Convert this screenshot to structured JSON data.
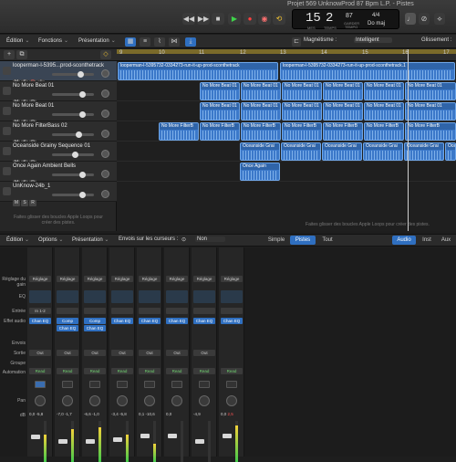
{
  "window": {
    "title": "Projet  569 UnknowProd 87 Bpm L.P. - Pistes"
  },
  "lcd": {
    "bar": "15",
    "beat": "2",
    "bar_label": "MES",
    "beat_label": "TEMPS",
    "tempo": "87",
    "tempo_label": "GARDER",
    "tempo_sub": "TEMPO",
    "signature": "4/4",
    "key": "Do maj"
  },
  "toolbar": {
    "edition": "Édition",
    "fonctions": "Fonctions",
    "presentation": "Présentation",
    "magnetisme_label": "Magnétisme :",
    "magnetisme_value": "Intelligent",
    "glissement_label": "Glissement :"
  },
  "ruler": [
    "9",
    "10",
    "11",
    "12",
    "13",
    "14",
    "15",
    "16",
    "17"
  ],
  "tracks": [
    {
      "name": "looperman-l-5395...prod-sconthetrack"
    },
    {
      "name": "No More Beat 01"
    },
    {
      "name": "No More Beat 01"
    },
    {
      "name": "No More FilterBass 02"
    },
    {
      "name": "Oceanside Grainy Sequence 01"
    },
    {
      "name": "Once Again Ambient Bells"
    },
    {
      "name": "UnKnow-24b_1"
    }
  ],
  "track_buttons": {
    "m": "M",
    "s": "S",
    "r": "R",
    "i": "I"
  },
  "regions": {
    "looper": "looperman-l-5395732-0334273-run-it-up-prod-sconthetrack",
    "looper2": "looperman-l-5395732-0334273-run-it-up-prod-sconthetrack.1",
    "beat": "No More Beat 01",
    "filterbass": "No More FilterB",
    "oceanside": "Oceanside Grai",
    "bells": "Once Again"
  },
  "hints": {
    "tracks": "Faites glisser des boucles Apple Loops pour créer des pistes.",
    "tracklist": "Faites glisser des boucles Apple Loops pour créer des pistes."
  },
  "mixer_bar": {
    "edition": "Édition",
    "options": "Options",
    "presentation": "Présentation",
    "envois": "Envois sur les curseurs :",
    "envois_value": "Non",
    "simple": "Simple",
    "pistes": "Pistes",
    "tout": "Tout",
    "audio": "Audio",
    "inst": "Inst",
    "aux": "Aux"
  },
  "mixer_rows": {
    "reglage_gain": "Réglage du gain",
    "eq": "EQ",
    "entree": "Entrée",
    "effet_audio": "Effet audio",
    "envois": "Envois",
    "sortie": "Sortie",
    "groupe": "Groupe",
    "automation": "Automation",
    "pan": "Pan",
    "db": "dB"
  },
  "strips": [
    {
      "reglage": "Réglage",
      "input": "In 1-2",
      "fx": [
        "Chan EQ"
      ],
      "out": "Out",
      "auto": "Read",
      "db1": "0,0",
      "db2": "-5,8",
      "red": false
    },
    {
      "reglage": "Réglage",
      "input": "",
      "fx": [
        "Comp",
        "Chan EQ"
      ],
      "out": "Out",
      "auto": "Read",
      "db1": "-7,0",
      "db2": "-1,7",
      "red": false
    },
    {
      "reglage": "Réglage",
      "input": "",
      "fx": [
        "Comp",
        "Chan EQ"
      ],
      "out": "Out",
      "auto": "Read",
      "db1": "-6,6",
      "db2": "-1,0",
      "red": false
    },
    {
      "reglage": "Réglage",
      "input": "",
      "fx": [
        "Chan EQ"
      ],
      "out": "Out",
      "auto": "Read",
      "db1": "-3,4",
      "db2": "-5,8",
      "red": false
    },
    {
      "reglage": "Réglage",
      "input": "",
      "fx": [
        "Chan EQ"
      ],
      "out": "Out",
      "auto": "Read",
      "db1": "0,1",
      "db2": "-10,6",
      "red": false
    },
    {
      "reglage": "Réglage",
      "input": "",
      "fx": [
        "Chan EQ"
      ],
      "out": "Out",
      "auto": "Read",
      "db1": "0,0",
      "db2": "",
      "red": false
    },
    {
      "reglage": "Réglage",
      "input": "",
      "fx": [
        "Chan EQ"
      ],
      "out": "Out",
      "auto": "Read",
      "db1": "-4,9",
      "db2": "",
      "red": false
    },
    {
      "reglage": "Réglage",
      "input": "",
      "fx": [
        "Chan EQ"
      ],
      "out": "",
      "auto": "Read",
      "db1": "0,0",
      "db2": "2,5",
      "red": true
    }
  ]
}
